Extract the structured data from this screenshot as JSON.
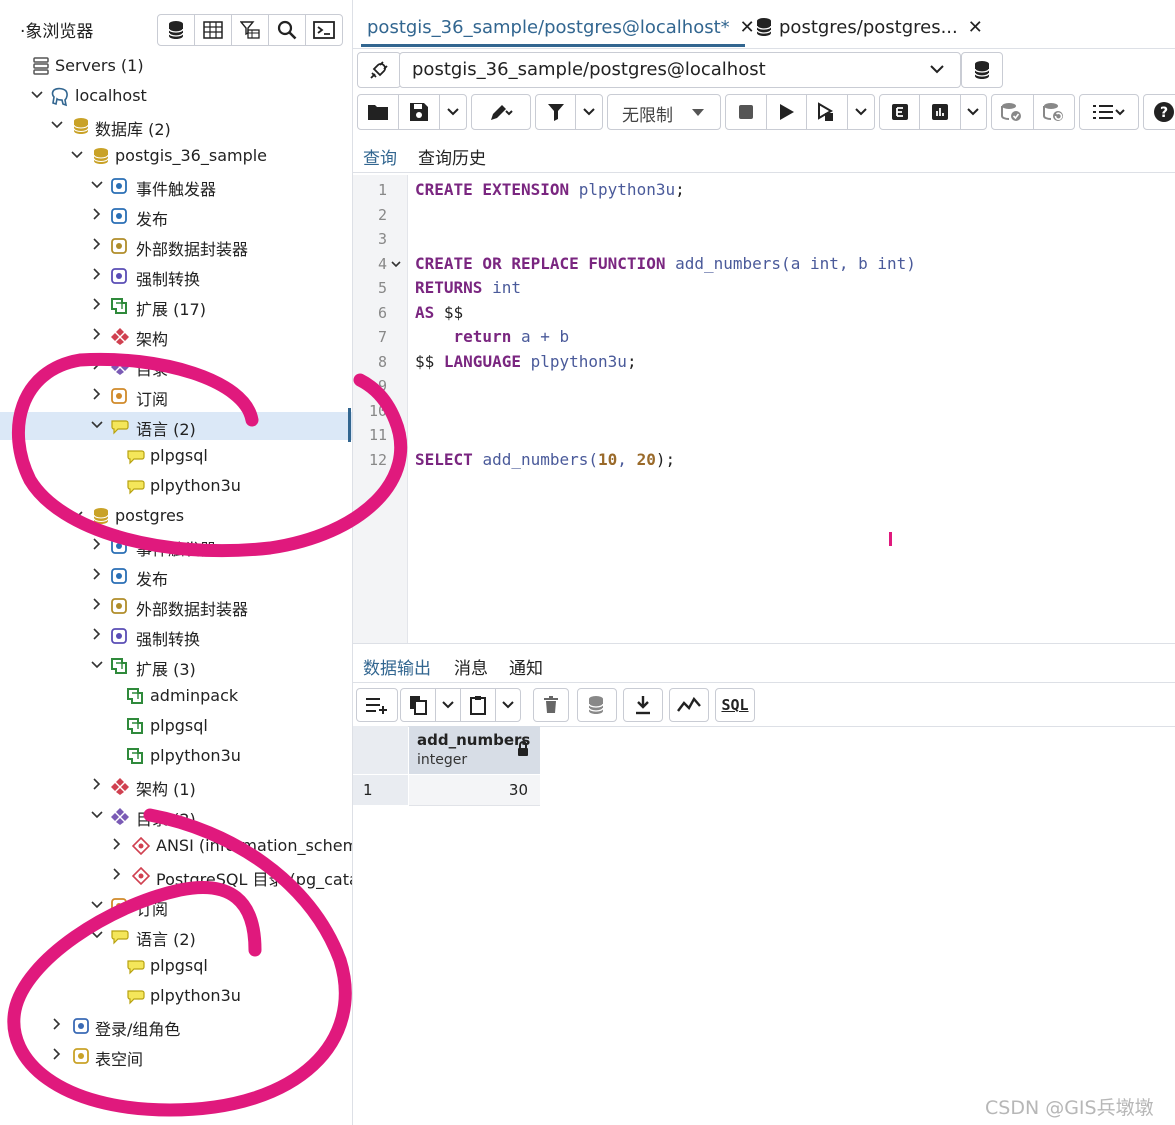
{
  "left_panel": {
    "title": "·象浏览器",
    "tree": [
      {
        "label": "Servers (1)",
        "icon": "servers-icon"
      },
      {
        "label": "localhost",
        "icon": "postgres-elephant-icon"
      },
      {
        "label": "数据库 (2)",
        "icon": "databases-icon"
      },
      {
        "label": "postgis_36_sample",
        "icon": "database-icon"
      },
      {
        "label": "事件触发器",
        "icon": "event-trigger-icon"
      },
      {
        "label": "发布",
        "icon": "publication-icon"
      },
      {
        "label": "外部数据封装器",
        "icon": "fdw-icon"
      },
      {
        "label": "强制转换",
        "icon": "cast-icon"
      },
      {
        "label": "扩展 (17)",
        "icon": "extension-icon"
      },
      {
        "label": "架构",
        "icon": "schema-icon"
      },
      {
        "label": "目录",
        "icon": "catalog-icon"
      },
      {
        "label": "订阅",
        "icon": "subscription-icon"
      },
      {
        "label": "语言 (2)",
        "icon": "language-icon"
      },
      {
        "label": "plpgsql",
        "icon": "language-item-icon"
      },
      {
        "label": "plpython3u",
        "icon": "language-item-icon"
      },
      {
        "label": "postgres",
        "icon": "database-icon"
      },
      {
        "label": "事件触发器",
        "icon": "event-trigger-icon"
      },
      {
        "label": "发布",
        "icon": "publication-icon"
      },
      {
        "label": "外部数据封装器",
        "icon": "fdw-icon"
      },
      {
        "label": "强制转换",
        "icon": "cast-icon"
      },
      {
        "label": "扩展 (3)",
        "icon": "extension-icon"
      },
      {
        "label": "adminpack",
        "icon": "extension-item-icon"
      },
      {
        "label": "plpgsql",
        "icon": "extension-item-icon"
      },
      {
        "label": "plpython3u",
        "icon": "extension-item-icon"
      },
      {
        "label": "架构 (1)",
        "icon": "schema-icon"
      },
      {
        "label": "目录 (2)",
        "icon": "catalog-icon"
      },
      {
        "label": "ANSI (information_schema)",
        "icon": "catalog-item-icon"
      },
      {
        "label": "PostgreSQL 目录 (pg_catalog)",
        "icon": "catalog-item-icon"
      },
      {
        "label": "订阅",
        "icon": "subscription-icon"
      },
      {
        "label": "语言 (2)",
        "icon": "language-icon"
      },
      {
        "label": "plpgsql",
        "icon": "language-item-icon"
      },
      {
        "label": "plpython3u",
        "icon": "language-item-icon"
      },
      {
        "label": "登录/组角色",
        "icon": "login-roles-icon"
      },
      {
        "label": "表空间",
        "icon": "tablespace-icon"
      }
    ]
  },
  "tabs": [
    {
      "label": "postgis_36_sample/postgres@localhost*"
    },
    {
      "label": "postgres/postgres..."
    }
  ],
  "connection": {
    "value": "postgis_36_sample/postgres@localhost"
  },
  "query_toolbar": {
    "limit_label": "无限制"
  },
  "editor_tabs": {
    "query": "查询",
    "history": "查询历史"
  },
  "editor": {
    "line_numbers": [
      "1",
      "2",
      "3",
      "4",
      "5",
      "6",
      "7",
      "8",
      "9",
      "10",
      "11",
      "12"
    ],
    "lines": [
      [
        {
          "t": "CREATE EXTENSION ",
          "c": "kw"
        },
        {
          "t": "plpython3u",
          "c": "fn"
        },
        {
          "t": ";",
          "c": "pl"
        }
      ],
      [],
      [],
      [
        {
          "t": "CREATE OR REPLACE FUNCTION ",
          "c": "kw"
        },
        {
          "t": "add_numbers(a ",
          "c": "fn"
        },
        {
          "t": "int",
          "c": "fn"
        },
        {
          "t": ", b ",
          "c": "fn"
        },
        {
          "t": "int",
          "c": "fn"
        },
        {
          "t": ")",
          "c": "fn"
        }
      ],
      [
        {
          "t": "RETURNS ",
          "c": "kw"
        },
        {
          "t": "int",
          "c": "fn"
        }
      ],
      [
        {
          "t": "AS ",
          "c": "kw"
        },
        {
          "t": "$$",
          "c": "pl"
        }
      ],
      [
        {
          "t": "    ",
          "c": "pl"
        },
        {
          "t": "return ",
          "c": "kw"
        },
        {
          "t": "a + b",
          "c": "fn"
        }
      ],
      [
        {
          "t": "$$ ",
          "c": "pl"
        },
        {
          "t": "LANGUAGE ",
          "c": "kw"
        },
        {
          "t": "plpython3u",
          "c": "fn"
        },
        {
          "t": ";",
          "c": "pl"
        }
      ],
      [],
      [],
      [],
      [
        {
          "t": "SELECT ",
          "c": "kw"
        },
        {
          "t": "add_numbers(",
          "c": "fn"
        },
        {
          "t": "10",
          "c": "num"
        },
        {
          "t": ", ",
          "c": "fn"
        },
        {
          "t": "20",
          "c": "num"
        },
        {
          "t": ");",
          "c": "pl"
        }
      ]
    ]
  },
  "output_tabs": {
    "data_output": "数据输出",
    "messages": "消息",
    "notifications": "通知"
  },
  "output_toolbar": {
    "sql_label": "SQL"
  },
  "result_grid": {
    "columns": [
      {
        "name": "add_numbers",
        "type": "integer"
      }
    ],
    "rows": [
      {
        "num": "1",
        "values": [
          "30"
        ]
      }
    ]
  },
  "colors": {
    "accent": "#326690",
    "annotation": "#e0197d",
    "selected_row": "#dbe8f7"
  },
  "watermark": "CSDN @GIS兵墩墩"
}
